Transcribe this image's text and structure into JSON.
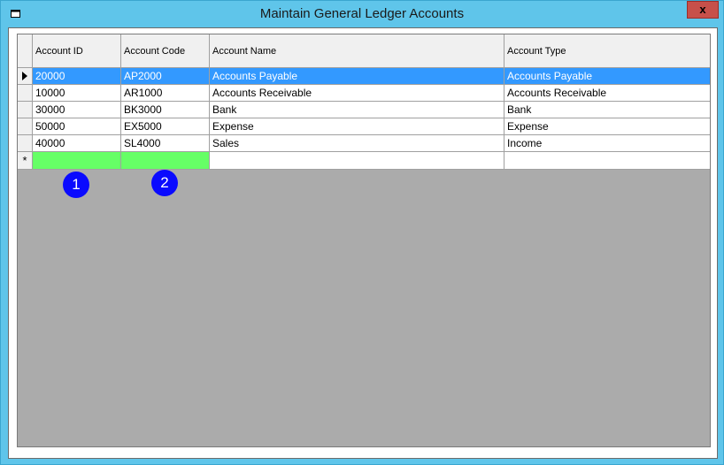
{
  "window": {
    "title": "Maintain General Ledger Accounts",
    "close_label": "x"
  },
  "grid": {
    "columns": [
      "Account ID",
      "Account Code",
      "Account Name",
      "Account Type"
    ],
    "rows": [
      {
        "id": "20000",
        "code": "AP2000",
        "name": "Accounts Payable",
        "type": "Accounts Payable",
        "selected": true
      },
      {
        "id": "10000",
        "code": "AR1000",
        "name": "Accounts Receivable",
        "type": "Accounts Receivable"
      },
      {
        "id": "30000",
        "code": "BK3000",
        "name": "Bank",
        "type": "Bank"
      },
      {
        "id": "50000",
        "code": "EX5000",
        "name": "Expense",
        "type": "Expense"
      },
      {
        "id": "40000",
        "code": "SL4000",
        "name": "Sales",
        "type": "Income"
      }
    ],
    "new_row_marker": "*"
  },
  "callouts": [
    "1",
    "2"
  ],
  "colors": {
    "title_bar": "#5fc5ea",
    "selection": "#3399ff",
    "highlight": "#66ff66",
    "callout": "#0a0aff"
  }
}
